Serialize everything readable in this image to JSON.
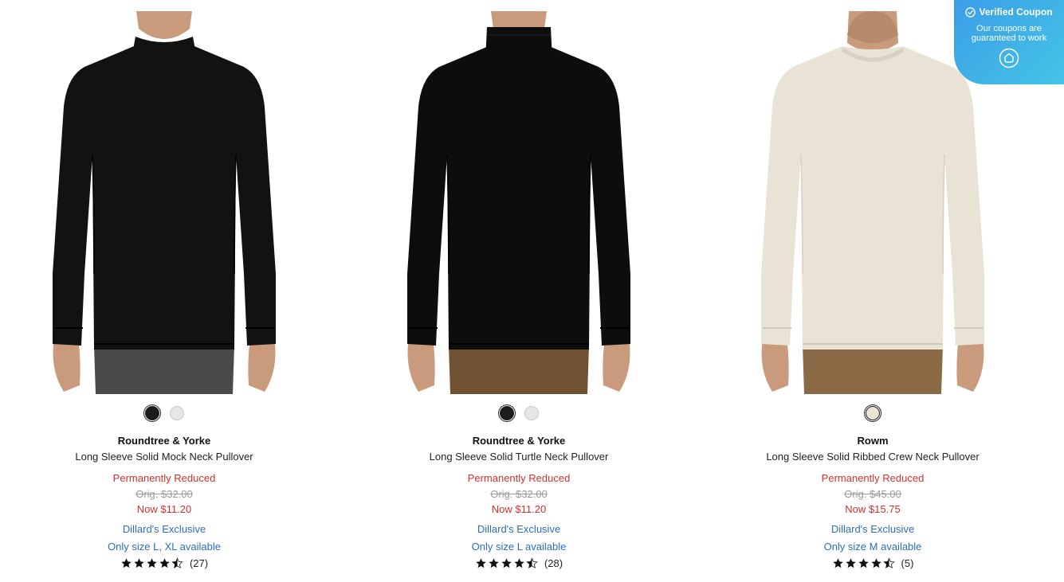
{
  "products": [
    {
      "brand": "Roundtree & Yorke",
      "name": "Long Sleeve Solid Mock Neck Pullover",
      "status": "Permanently Reduced",
      "orig_price": "Orig. $32.00",
      "now_price": "Now $11.20",
      "exclusive": "Dillard's Exclusive",
      "availability": "Only size L, XL available",
      "rating": 4.5,
      "review_count": "(27)",
      "swatches": [
        "#1c1c1c",
        "#e6e6e6"
      ],
      "shirt_color": "#121212",
      "pants_color": "#4a4a4a",
      "neck": "mock"
    },
    {
      "brand": "Roundtree & Yorke",
      "name": "Long Sleeve Solid Turtle Neck Pullover",
      "status": "Permanently Reduced",
      "orig_price": "Orig. $32.00",
      "now_price": "Now $11.20",
      "exclusive": "Dillard's Exclusive",
      "availability": "Only size L available",
      "rating": 4.5,
      "review_count": "(28)",
      "swatches": [
        "#1c1c1c",
        "#e6e6e6"
      ],
      "shirt_color": "#0d0d0d",
      "pants_color": "#6e5232",
      "neck": "turtle"
    },
    {
      "brand": "Rowm",
      "name": "Long Sleeve Solid Ribbed Crew Neck Pullover",
      "status": "Permanently Reduced",
      "orig_price": "Orig. $45.00",
      "now_price": "Now $15.75",
      "exclusive": "Dillard's Exclusive",
      "availability": "Only size M available",
      "rating": 4.5,
      "review_count": "(5)",
      "swatches": [
        "#ebe3d3"
      ],
      "shirt_color": "#e9e3d6",
      "pants_color": "#8a6a45",
      "neck": "crew"
    }
  ],
  "coupon": {
    "title": "Verified Coupon",
    "subtitle": "Our coupons are guaranteed to work",
    "icon": "coupon-logo-icon",
    "colors": [
      "#3b9ee8",
      "#45c4e6"
    ]
  },
  "icons": {
    "star": "star-icon",
    "half_star": "half-star-icon"
  }
}
